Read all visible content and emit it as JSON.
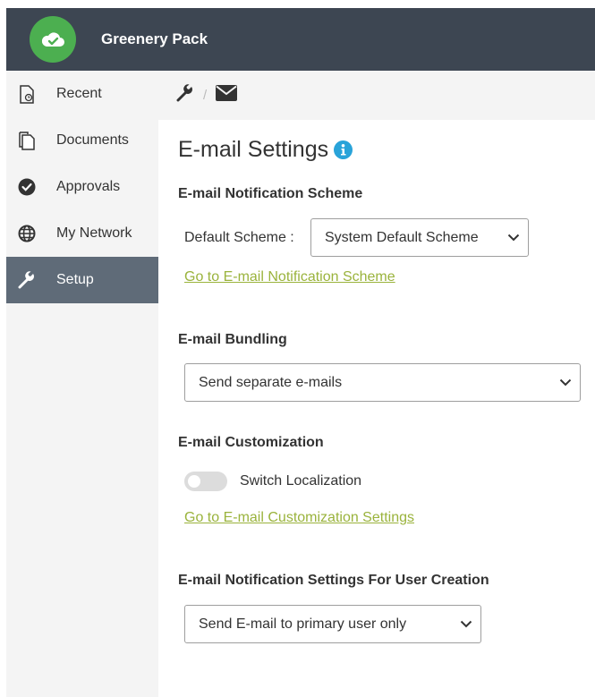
{
  "app": {
    "name": "Greenery Pack"
  },
  "sidebar": {
    "items": [
      {
        "label": "Recent",
        "icon": "recent-document-icon"
      },
      {
        "label": "Documents",
        "icon": "documents-icon"
      },
      {
        "label": "Approvals",
        "icon": "check-circle-icon"
      },
      {
        "label": "My Network",
        "icon": "globe-icon"
      },
      {
        "label": "Setup",
        "icon": "wrench-icon",
        "active": true
      }
    ]
  },
  "breadcrumb": {
    "separator": "/",
    "items": [
      "wrench-icon",
      "envelope-icon"
    ]
  },
  "page": {
    "title": "E-mail Settings",
    "notification_scheme": {
      "heading": "E-mail Notification Scheme",
      "default_label": "Default Scheme :",
      "default_value": "System Default Scheme",
      "link": "Go to E-mail Notification Scheme"
    },
    "bundling": {
      "heading": "E-mail Bundling",
      "value": "Send separate e-mails"
    },
    "customization": {
      "heading": "E-mail Customization",
      "toggle_label": "Switch Localization",
      "toggle_on": false,
      "link": "Go to E-mail Customization Settings"
    },
    "user_creation": {
      "heading": "E-mail Notification Settings For User Creation",
      "value": "Send E-mail to primary user only"
    }
  },
  "colors": {
    "header_bg": "#3d4652",
    "logo_green": "#4caf50",
    "active_nav": "#5f6b78",
    "link": "#9ab33c",
    "info": "#29a3d9"
  }
}
